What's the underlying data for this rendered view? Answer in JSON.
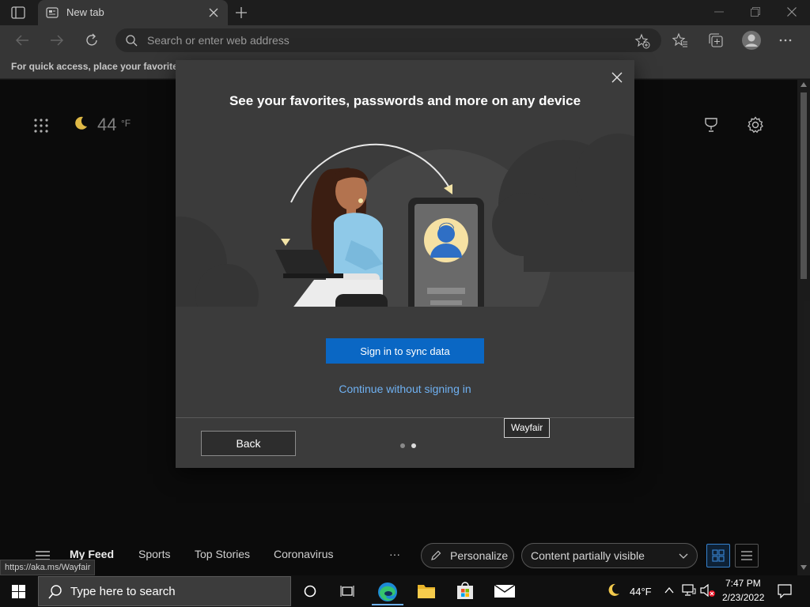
{
  "browser": {
    "tab_title": "New tab",
    "address_placeholder": "Search or enter web address",
    "favorites_bar_text": "For quick access, place your favorites h"
  },
  "ntp": {
    "weather_temp": "44",
    "weather_unit": "°F",
    "nav": [
      "My Feed",
      "Sports",
      "Top Stories",
      "Coronavirus"
    ],
    "more_label": "···",
    "personalize_label": "Personalize",
    "content_select_value": "Content partially visible",
    "status_url": "https://aka.ms/Wayfair"
  },
  "dialog": {
    "title": "See your favorites, passwords and more on any device",
    "signin_label": "Sign in to sync data",
    "continue_label": "Continue without signing in",
    "back_label": "Back",
    "tooltip": "Wayfair",
    "pager": {
      "total": 2,
      "current": 2
    }
  },
  "taskbar": {
    "search_placeholder": "Type here to search",
    "weather": "44°F",
    "time": "7:47 PM",
    "date": "2/23/2022"
  },
  "colors": {
    "accent": "#0a67c4",
    "link": "#6fb1f2",
    "dialog_bg": "#3b3b3b"
  },
  "icons": [
    "tab-actions-icon",
    "newtab-page-icon",
    "close-tab-icon",
    "new-tab-icon",
    "minimize-icon",
    "restore-icon",
    "close-window-icon",
    "back-icon",
    "forward-icon",
    "refresh-icon",
    "search-icon",
    "add-favorite-icon",
    "favorites-icon",
    "collections-icon",
    "profile-icon",
    "settings-more-icon",
    "apps-grid-icon",
    "moon-icon",
    "rewards-icon",
    "gear-icon",
    "hamburger-icon",
    "pencil-icon",
    "chevron-down-icon",
    "grid-view-icon",
    "list-view-icon",
    "windows-start-icon",
    "task-view-icon",
    "edge-icon",
    "file-explorer-icon",
    "store-icon",
    "mail-icon",
    "network-icon",
    "volume-muted-icon",
    "notification-icon"
  ]
}
